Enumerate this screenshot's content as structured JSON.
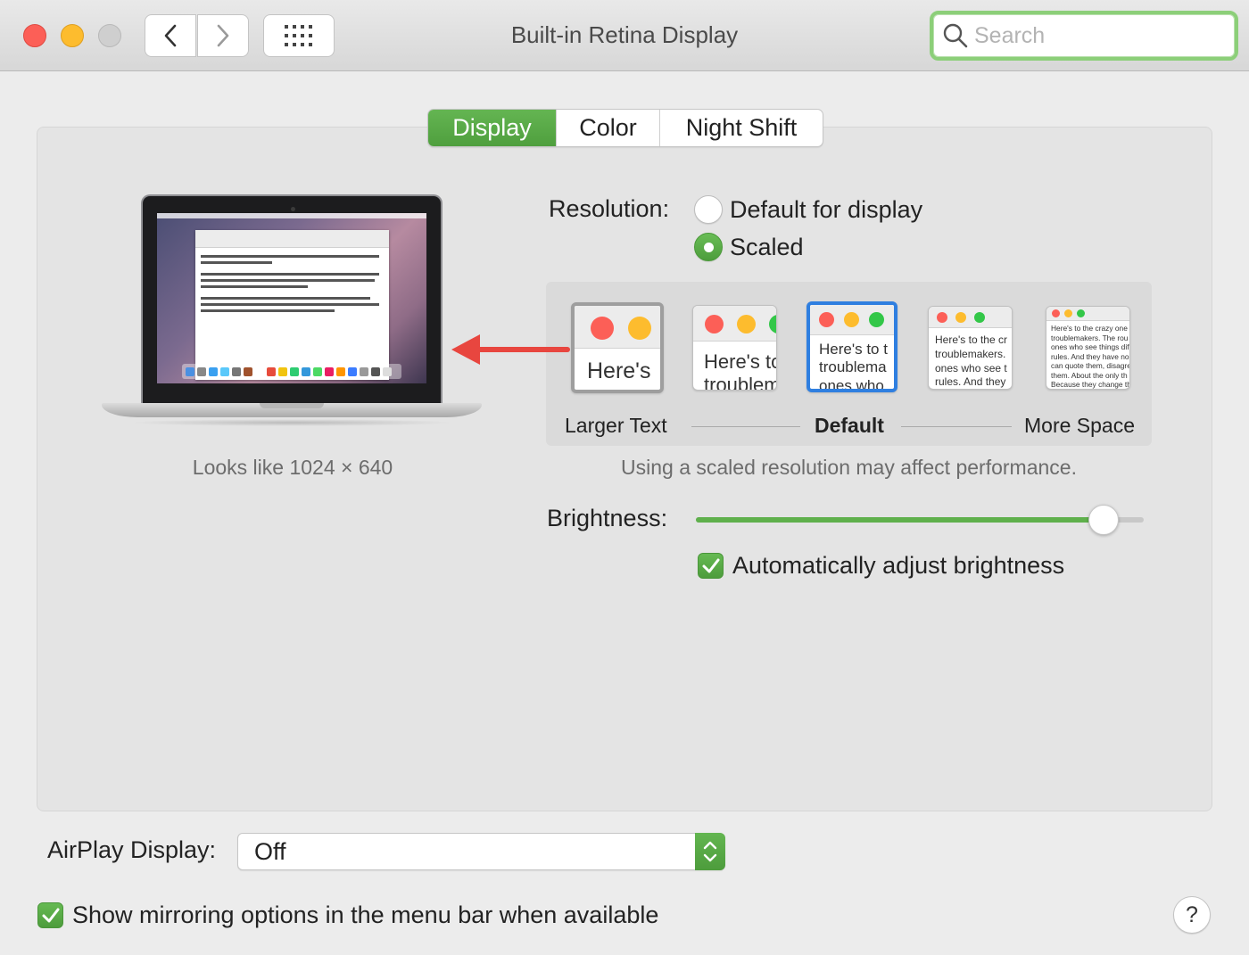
{
  "window": {
    "title": "Built-in Retina Display",
    "search_placeholder": "Search"
  },
  "tabs": [
    {
      "label": "Display",
      "active": true
    },
    {
      "label": "Color",
      "active": false
    },
    {
      "label": "Night Shift",
      "active": false
    }
  ],
  "preview": {
    "looks_like": "Looks like 1024 × 640"
  },
  "resolution": {
    "label": "Resolution:",
    "options": [
      {
        "label": "Default for display",
        "selected": false
      },
      {
        "label": "Scaled",
        "selected": true
      }
    ],
    "scale_thumbnails": [
      {
        "text": "Here's"
      },
      {
        "text": "Here's to\ntroublem"
      },
      {
        "text": "Here's to t\ntroublema\nones who"
      },
      {
        "text": "Here's to the cr\ntroublemakers.\nones who see t\nrules. And they"
      },
      {
        "text": "Here's to the crazy one\ntroublemakers. The rou\nones who see things dif\nrules. And they have no\ncan quote them, disagre\nthem. About the only th\nBecause they change th"
      }
    ],
    "scale_labels": {
      "left": "Larger Text",
      "middle": "Default",
      "right": "More Space"
    },
    "note": "Using a scaled resolution may affect performance."
  },
  "brightness": {
    "label": "Brightness:",
    "level": 0.91,
    "auto_label": "Automatically adjust brightness",
    "auto_checked": true
  },
  "airplay": {
    "label": "AirPlay Display:",
    "value": "Off"
  },
  "mirroring": {
    "label": "Show mirroring options in the menu bar when available",
    "checked": true
  },
  "help": "?",
  "colors": {
    "accent_green": "#5fb04c",
    "selection_blue": "#2f7fe0",
    "annotation_red": "#e8463f"
  }
}
